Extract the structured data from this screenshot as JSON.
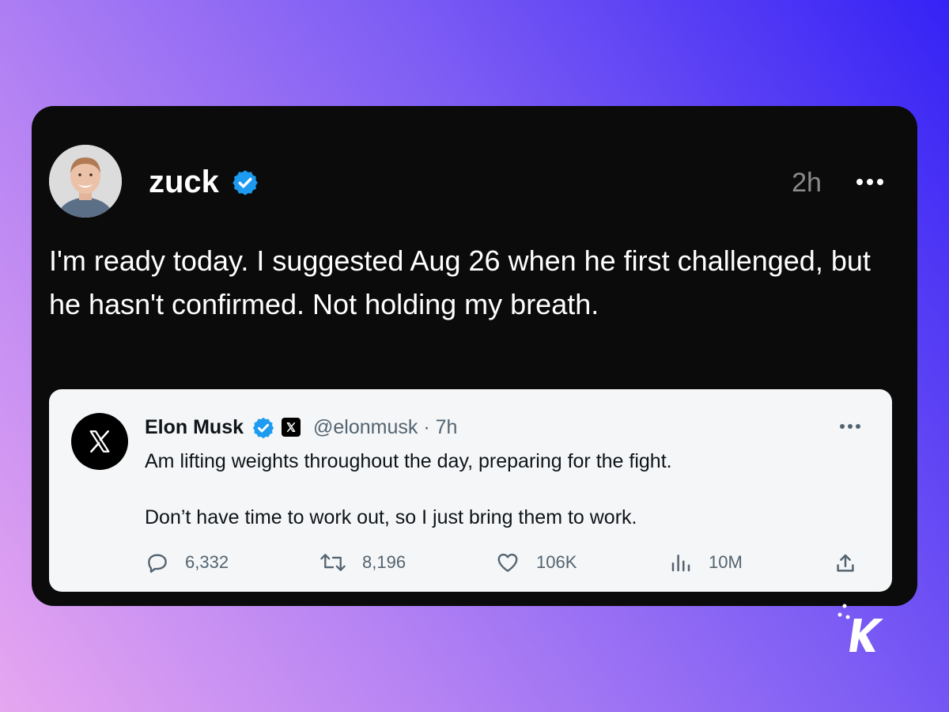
{
  "post": {
    "username": "zuck",
    "time": "2h",
    "text": "I'm ready today. I suggested Aug 26 when he first challenged, but he hasn't confirmed. Not holding my breath."
  },
  "quote": {
    "name": "Elon Musk",
    "handle_time": "@elonmusk · 7h",
    "line1": "Am lifting weights throughout the day, preparing for the fight.",
    "line2": "Don’t have time to work out, so I just bring them to work.",
    "stats": {
      "replies": "6,332",
      "retweets": "8,196",
      "likes": "106K",
      "views": "10M"
    }
  },
  "colors": {
    "verified_blue": "#1d9bf0",
    "card_bg": "#0b0b0b",
    "quote_bg": "#f5f6f7",
    "muted": "#536471"
  },
  "icons": [
    "verified-badge-icon",
    "more-icon",
    "x-logo-icon",
    "reply-icon",
    "retweet-icon",
    "like-icon",
    "views-icon",
    "share-icon",
    "brand-k-logo"
  ]
}
